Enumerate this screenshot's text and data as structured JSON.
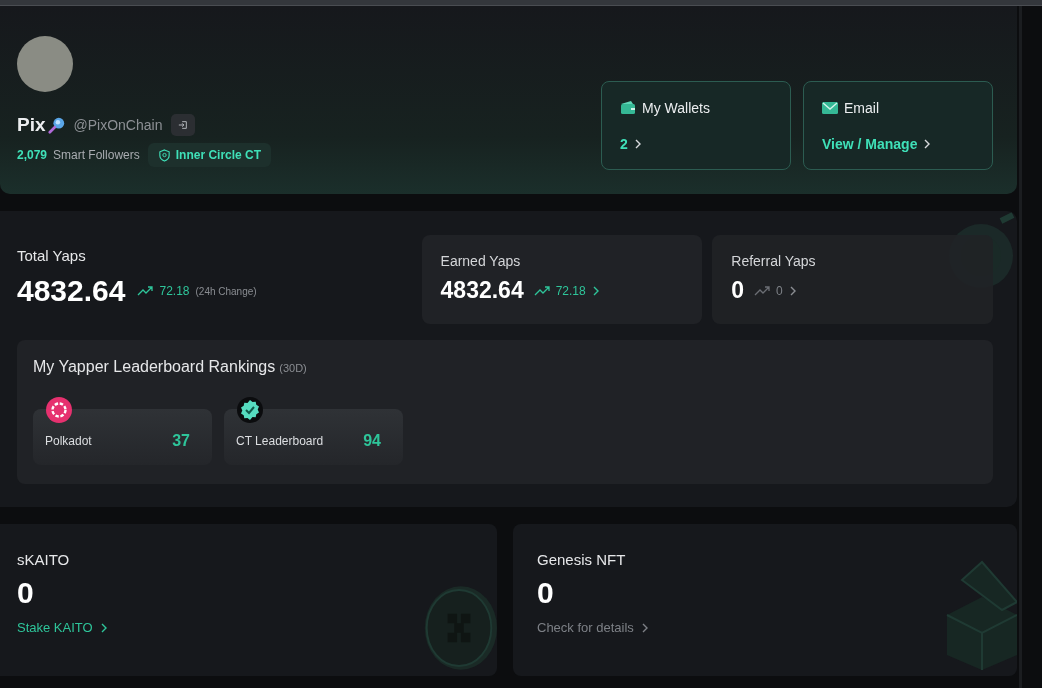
{
  "profile": {
    "name": "Pix",
    "handle": "@PixOnChain",
    "followers_count": "2,079",
    "followers_label": "Smart Followers",
    "badge": "Inner Circle CT"
  },
  "account_cards": [
    {
      "kind": "wallet",
      "title": "My Wallets",
      "value": "2"
    },
    {
      "kind": "email",
      "title": "Email",
      "value": "View / Manage"
    }
  ],
  "total_yaps": {
    "label": "Total Yaps",
    "value": "4832.64",
    "change": "72.18",
    "note": "(24h Change)"
  },
  "yap_cards": [
    {
      "label": "Earned Yaps",
      "value": "4832.64",
      "change": "72.18",
      "positive": true
    },
    {
      "label": "Referral Yaps",
      "value": "0",
      "change": "0",
      "positive": false
    }
  ],
  "rankings": {
    "title": "My Yapper Leaderboard Rankings",
    "period": "(30D)",
    "items": [
      {
        "kind": "polkadot",
        "name": "Polkadot",
        "rank": "37"
      },
      {
        "kind": "verified",
        "name": "CT Leaderboard",
        "rank": "94"
      }
    ]
  },
  "asset_cards": [
    {
      "kind": "coin",
      "title": "sKAITO",
      "value": "0",
      "link": "Stake KAITO",
      "highlighted": true
    },
    {
      "kind": "box",
      "title": "Genesis NFT",
      "value": "0",
      "link": "Check for details",
      "highlighted": false
    }
  ]
}
